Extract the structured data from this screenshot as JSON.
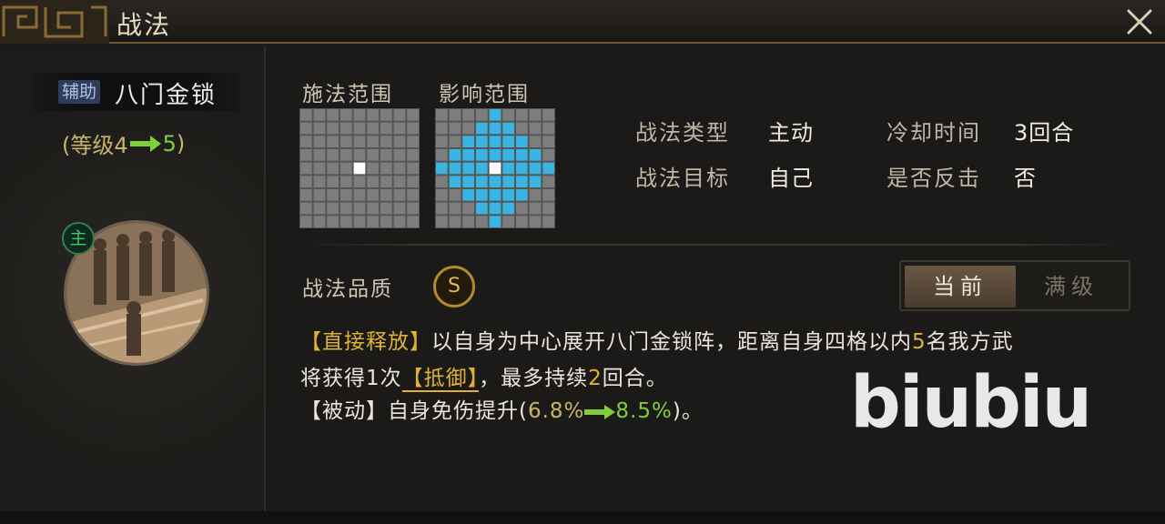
{
  "window": {
    "title": "战法",
    "close_icon": "close-icon"
  },
  "skill": {
    "tag": "辅助",
    "name": "八门金锁",
    "level_prefix": "(等级4",
    "level_to": "5",
    "level_suffix": ")",
    "commander_badge": "主"
  },
  "ranges": {
    "cast_label": "施法范围",
    "effect_label": "影响范围"
  },
  "info": {
    "type_label": "战法类型",
    "type_value": "主动",
    "cooldown_label": "冷却时间",
    "cooldown_value": "3回合",
    "target_label": "战法目标",
    "target_value": "自己",
    "counter_label": "是否反击",
    "counter_value": "否"
  },
  "quality": {
    "label": "战法品质",
    "grade": "S"
  },
  "toggle": {
    "current": "当前",
    "max": "满级",
    "selected": "当前"
  },
  "description": {
    "l1_tag": "【直接释放】",
    "l1_text_a": "以自身为中心展开八门金锁阵，距离自身四格以内",
    "l1_num": "5",
    "l1_text_b": "名我方武",
    "l2_text_a": "将获得1次",
    "l2_status": "【抵御】",
    "l2_text_b": "，最多持续",
    "l2_num": "2",
    "l2_text_c": "回合。",
    "l3_tag": "【被动】",
    "l3_text_a": "自身免伤提升(",
    "l3_old": "6.8%",
    "l3_new": "8.5%",
    "l3_text_b": ")。"
  },
  "watermark": "biubiu",
  "colors": {
    "accent_gold": "#e0b335",
    "increase_green": "#7ecf3a",
    "grid_cell": "#7d7d7d",
    "effect_cell": "#3ab4e0"
  }
}
